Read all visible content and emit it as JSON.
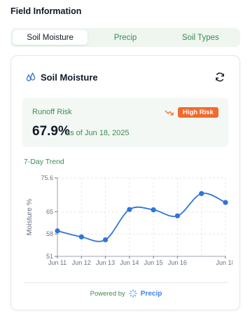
{
  "page": {
    "title": "Field Information"
  },
  "tabs": [
    {
      "label": "Soil Moisture",
      "active": true
    },
    {
      "label": "Precip",
      "active": false
    },
    {
      "label": "Soil Types",
      "active": false
    }
  ],
  "card": {
    "title": "Soil Moisture",
    "icon": "water-drops-icon",
    "refresh_icon": "refresh-icon"
  },
  "risk": {
    "label": "Runoff Risk",
    "value": "67.9%",
    "date_text": "as of Jun 18, 2025",
    "badge": "High Risk",
    "badge_color": "#f26a2e",
    "trend_icon": "trending-down-icon"
  },
  "trend": {
    "title": "7-Day Trend"
  },
  "chart_data": {
    "type": "line",
    "ylabel": "Moisture %",
    "ylim": [
      51,
      75.6
    ],
    "y_ticks": [
      "75.6",
      "65",
      "58",
      "51"
    ],
    "x_tick_labels": [
      "Jun 11",
      "Jun 12",
      "Jun 13",
      "Jun 14",
      "Jun 15",
      "Jun 16",
      "Jun 18"
    ],
    "x": [
      11,
      12,
      13,
      14,
      15,
      16,
      17,
      18
    ],
    "values": [
      59.0,
      57.1,
      56.2,
      65.7,
      65.6,
      63.7,
      70.7,
      67.9
    ],
    "color": "#2f74d8",
    "grid": true
  },
  "footer": {
    "powered": "Powered by",
    "brand": "Precip",
    "brand_icon": "spinner-icon"
  }
}
